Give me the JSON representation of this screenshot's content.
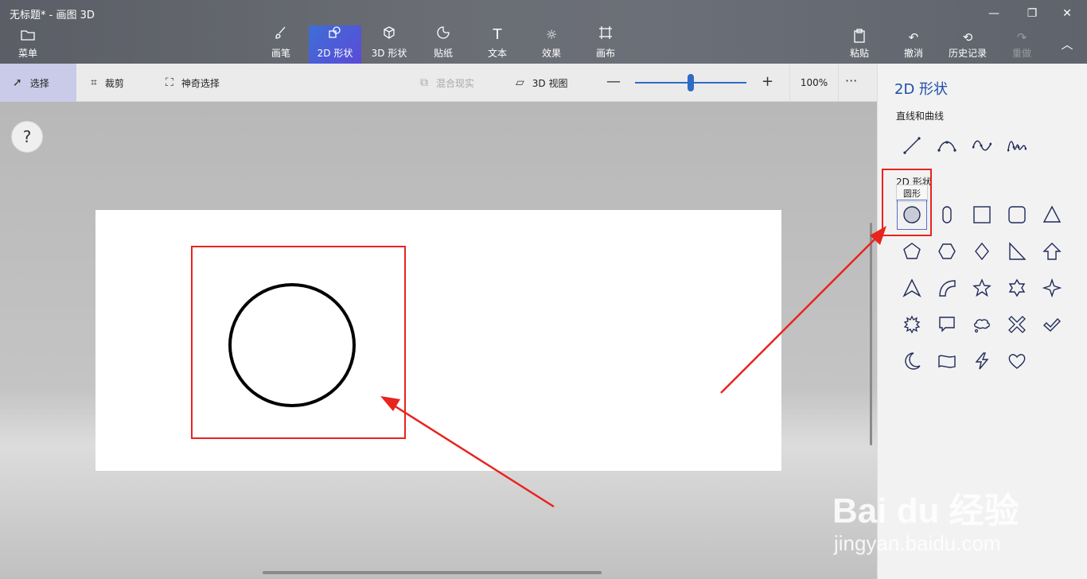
{
  "window": {
    "title": "无标题* - 画图 3D"
  },
  "ribbon": {
    "menu_label": "菜单",
    "tools": [
      {
        "label": "画笔"
      },
      {
        "label": "2D 形状"
      },
      {
        "label": "3D 形状"
      },
      {
        "label": "贴纸"
      },
      {
        "label": "文本"
      },
      {
        "label": "效果"
      },
      {
        "label": "画布"
      }
    ],
    "right": [
      {
        "label": "粘贴"
      },
      {
        "label": "撤消"
      },
      {
        "label": "历史记录"
      },
      {
        "label": "重做"
      }
    ]
  },
  "subbar": {
    "select": "选择",
    "crop": "裁剪",
    "magic_select": "神奇选择",
    "mixed_reality": "混合现实",
    "view3d": "3D 视图",
    "zoom": "100%",
    "more": "···"
  },
  "help": "?",
  "panel": {
    "title": "2D 形状",
    "lines_label": "直线和曲线",
    "shapes_label": "2D 形状",
    "tooltip": "圆形"
  },
  "watermark": {
    "brand": "Bai du 经验",
    "url": "jingyan.baidu.com"
  }
}
